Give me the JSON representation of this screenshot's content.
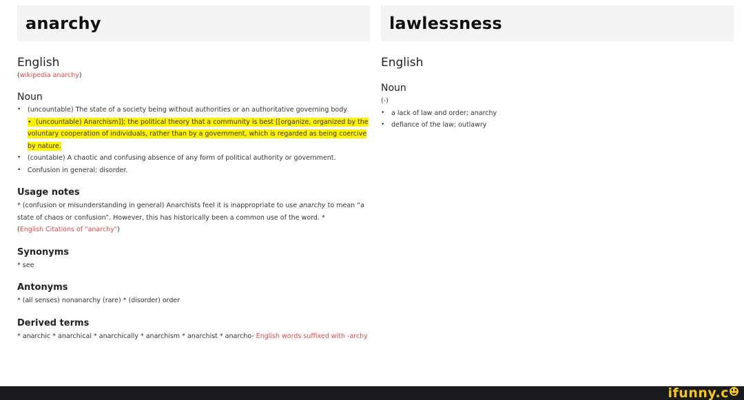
{
  "left": {
    "title": "anarchy",
    "language": "English",
    "wiki_open": "(",
    "wiki_link": "wikipedia anarchy",
    "wiki_close": ")",
    "noun": {
      "heading": "Noun",
      "definitions": [
        "(uncountable) The state of a society being without authorities or an authoritative governing body.",
        "(uncountable) Anarchism]]; the political theory that a community is best [[organize, organized by the voluntary cooperation of individuals, rather than by a government, which is regarded as being coercive by nature.",
        "(countable) A chaotic and confusing absence of any form of political authority or government.",
        "Confusion in general; disorder."
      ],
      "highlighted_index": 1,
      "highlight_color": "#fff200"
    },
    "usage_notes": {
      "heading": "Usage notes",
      "text_before_italic": "* (confusion or misunderstanding in general) Anarchists feel it is inappropriate to use ",
      "italic": "anarchy",
      "text_after_italic": " to mean “a state of chaos or confusion”. However, this has historically been a common use of the word. *",
      "citation_open": "(",
      "citation_link": "English Citations of \"anarchy\"",
      "citation_close": ")"
    },
    "synonyms": {
      "heading": "Synonyms",
      "text": "* see"
    },
    "antonyms": {
      "heading": "Antonyms",
      "text": "* (all senses) nonanarchy (rare) * (disorder) order"
    },
    "derived_terms": {
      "heading": "Derived terms",
      "text": "* anarchic * anarchical * anarchically * anarchism * anarchist * anarcho- ",
      "link": "English words suffixed with -archy"
    }
  },
  "right": {
    "title": "lawlessness",
    "language": "English",
    "noun": {
      "heading": "Noun",
      "inflection": "(-)",
      "definitions": [
        "a lack of law and order; anarchy",
        "defiance of the law; outlawry"
      ]
    }
  },
  "footer": {
    "brand": "ifunny.co",
    "brand_color": "#f5c518",
    "background": "#1b1b1e"
  },
  "colors": {
    "link": "#e0484b",
    "title_box": "#f4f4f4"
  }
}
